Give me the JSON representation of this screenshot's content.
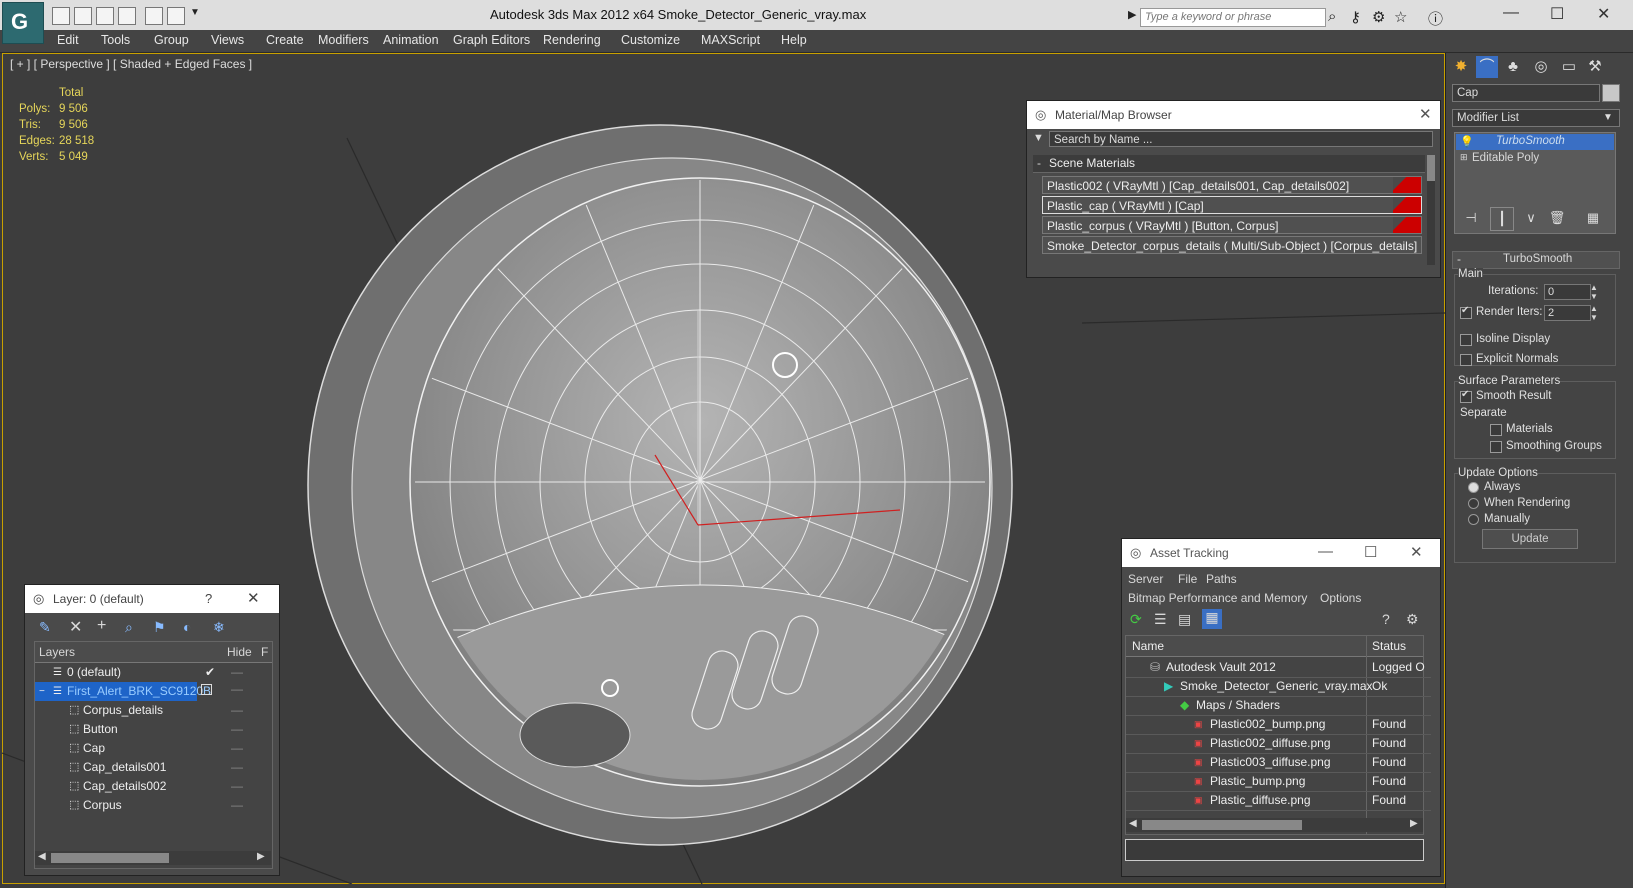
{
  "window": {
    "title": "Autodesk 3ds Max  2012 x64        Smoke_Detector_Generic_vray.max",
    "search_placeholder": "Type a keyword or phrase"
  },
  "menu": [
    "Edit",
    "Tools",
    "Group",
    "Views",
    "Create",
    "Modifiers",
    "Animation",
    "Graph Editors",
    "Rendering",
    "Customize",
    "MAXScript",
    "Help"
  ],
  "viewport": {
    "label": "[ + ] [ Perspective ] [ Shaded + Edged Faces ]",
    "stats_header": "Total",
    "stats": [
      {
        "label": "Polys:",
        "value": "9 506"
      },
      {
        "label": "Tris:",
        "value": "9 506"
      },
      {
        "label": "Edges:",
        "value": "28 518"
      },
      {
        "label": "Verts:",
        "value": "5 049"
      }
    ]
  },
  "material_browser": {
    "title": "Material/Map Browser",
    "search_placeholder": "Search by Name ...",
    "group": "Scene Materials",
    "group_toggle": "-",
    "items": [
      "Plastic002  ( VRayMtl ) [Cap_details001, Cap_details002]",
      "Plastic_cap  ( VRayMtl ) [Cap]",
      "Plastic_corpus  ( VRayMtl ) [Button, Corpus]",
      "Smoke_Detector_corpus_details  ( Multi/Sub-Object ) [Corpus_details]"
    ]
  },
  "asset_tracking": {
    "title": "Asset Tracking",
    "menu1": [
      "Server",
      "File",
      "Paths"
    ],
    "menu2": [
      "Bitmap Performance and Memory",
      "Options"
    ],
    "col_name": "Name",
    "col_status": "Status",
    "rows": [
      {
        "name": "Autodesk Vault 2012",
        "status": "Logged O",
        "indent": 1,
        "icon": "vault-icon"
      },
      {
        "name": "Smoke_Detector_Generic_vray.max",
        "status": "Ok",
        "indent": 2,
        "icon": "max-file-icon"
      },
      {
        "name": "Maps / Shaders",
        "status": "",
        "indent": 3,
        "icon": "maps-icon"
      },
      {
        "name": "Plastic002_bump.png",
        "status": "Found",
        "indent": 4,
        "icon": "png-icon"
      },
      {
        "name": "Plastic002_diffuse.png",
        "status": "Found",
        "indent": 4,
        "icon": "png-icon"
      },
      {
        "name": "Plastic003_diffuse.png",
        "status": "Found",
        "indent": 4,
        "icon": "png-icon"
      },
      {
        "name": "Plastic_bump.png",
        "status": "Found",
        "indent": 4,
        "icon": "png-icon"
      },
      {
        "name": "Plastic_diffuse.png",
        "status": "Found",
        "indent": 4,
        "icon": "png-icon"
      }
    ]
  },
  "layer_dialog": {
    "title": "Layer: 0 (default)",
    "help": "?",
    "col_layers": "Layers",
    "col_hide": "Hide",
    "col_f": "F",
    "rows": [
      {
        "name": "0 (default)",
        "indent": 1,
        "selected": false
      },
      {
        "name": "First_Alert_BRK_SC9120B",
        "indent": 1,
        "selected": true
      },
      {
        "name": "Corpus_details",
        "indent": 2,
        "selected": false
      },
      {
        "name": "Button",
        "indent": 2,
        "selected": false
      },
      {
        "name": "Cap",
        "indent": 2,
        "selected": false
      },
      {
        "name": "Cap_details001",
        "indent": 2,
        "selected": false
      },
      {
        "name": "Cap_details002",
        "indent": 2,
        "selected": false
      },
      {
        "name": "Corpus",
        "indent": 2,
        "selected": false
      }
    ]
  },
  "command_panel": {
    "object_name": "Cap",
    "modifier_list": "Modifier List",
    "stack": [
      "TurboSmooth",
      "Editable Poly"
    ],
    "rollout": "TurboSmooth",
    "rollout_toggle": "-",
    "main": "Main",
    "iterations_label": "Iterations:",
    "iterations_value": "0",
    "render_iters_label": "Render Iters:",
    "render_iters_value": "2",
    "isoline": "Isoline Display",
    "explicit": "Explicit Normals",
    "surface": "Surface Parameters",
    "smooth_result": "Smooth Result",
    "separate": "Separate",
    "materials": "Materials",
    "smoothing_groups": "Smoothing Groups",
    "update_options": "Update Options",
    "always": "Always",
    "when_rendering": "When Rendering",
    "manually": "Manually",
    "update_button": "Update"
  },
  "colors": {
    "accent": "#3a6fc4",
    "selection": "#1e64c8",
    "viewport_border": "#c8a000",
    "stats": "#e6d65a"
  }
}
